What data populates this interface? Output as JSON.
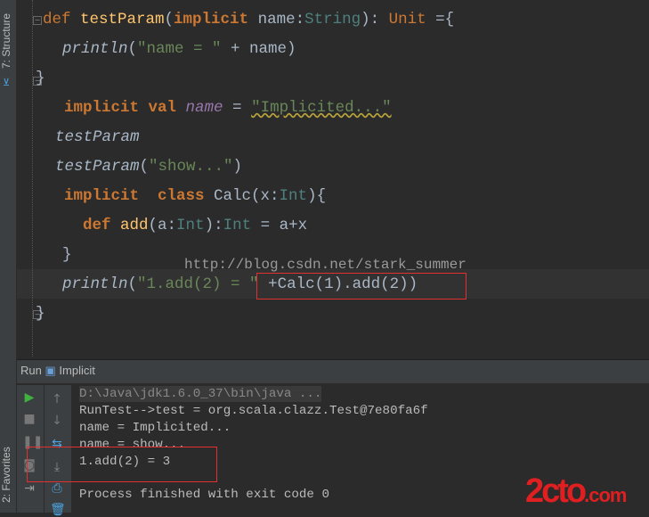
{
  "sidebar": {
    "structure_tab": "7: Structure",
    "favorites_tab": "2: Favorites"
  },
  "editor": {
    "lines": [
      [
        [
          "def ",
          "kwn"
        ],
        [
          "testParam",
          "fn"
        ],
        [
          "(",
          ""
        ],
        [
          "implicit ",
          "kw"
        ],
        [
          "name:",
          ""
        ],
        [
          "String",
          "ty"
        ],
        [
          "): ",
          ""
        ],
        [
          "Unit ",
          "kwn"
        ],
        [
          "={",
          ""
        ]
      ],
      [
        [
          "println",
          "it"
        ],
        [
          "(",
          ""
        ],
        [
          "\"name = \"",
          "str"
        ],
        [
          " + name)",
          ""
        ]
      ],
      [
        [
          "}",
          ""
        ]
      ],
      [
        [
          "implicit val ",
          "kw"
        ],
        [
          "name",
          "pv"
        ],
        [
          " = ",
          ""
        ],
        [
          "\"Implicited...\"",
          "str"
        ]
      ],
      [
        [
          "testParam",
          "it"
        ]
      ],
      [
        [
          "testParam",
          "it"
        ],
        [
          "(",
          ""
        ],
        [
          "\"show...\"",
          "str"
        ],
        [
          ")",
          ""
        ]
      ],
      [
        [
          "implicit  class ",
          "kw"
        ],
        [
          "Calc(x:",
          ""
        ],
        [
          "Int",
          "ty"
        ],
        [
          "){",
          ""
        ]
      ],
      [
        [
          "def ",
          "kw"
        ],
        [
          "add",
          "fn"
        ],
        [
          "(a:",
          ""
        ],
        [
          "Int",
          "ty"
        ],
        [
          "):",
          ""
        ],
        [
          "Int",
          "ty"
        ],
        [
          " = a+x",
          ""
        ]
      ],
      [
        [
          "}",
          ""
        ]
      ],
      [
        [
          "println",
          "it"
        ],
        [
          "(",
          ""
        ],
        [
          "\"1.add(2) = \"",
          "str"
        ],
        [
          " +Calc(1).add(2))",
          ""
        ]
      ],
      [
        [
          "}",
          ""
        ]
      ]
    ],
    "watermark": "http://blog.csdn.net/stark_summer"
  },
  "run_panel": {
    "title": "Run",
    "config": "Implicit",
    "console": [
      "D:\\Java\\jdk1.6.0_37\\bin\\java ...",
      "RunTest-->test = org.scala.clazz.Test@7e80fa6f",
      "name = Implicited...",
      "name = show...",
      "1.add(2) = 3",
      "Process finished with exit code 0"
    ]
  },
  "logo": {
    "text": "2cto",
    "suffix": ".com"
  },
  "colors": {
    "accent_red": "#e03030",
    "run_green": "#3fb23f"
  }
}
